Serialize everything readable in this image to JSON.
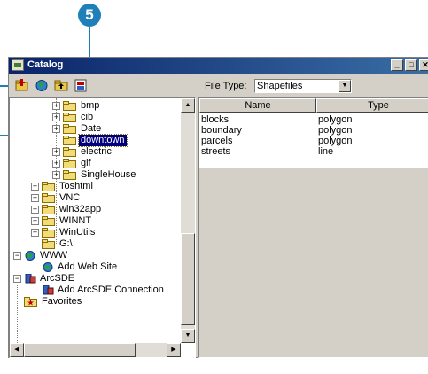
{
  "callout": {
    "number": "5",
    "color": "#1f7fb8"
  },
  "window": {
    "title": "Catalog"
  },
  "window_buttons": {
    "minimize": "_",
    "maximize": "□",
    "close": "✕"
  },
  "toolbar": {
    "buttons": [
      "connect-folder-icon",
      "globe-icon",
      "up-folder-icon",
      "launch-icon"
    ],
    "file_type_label": "File Type:",
    "file_type_value": "Shapefiles"
  },
  "tree": {
    "items": [
      {
        "label": "bmp",
        "expander": "+"
      },
      {
        "label": "cib",
        "expander": "+"
      },
      {
        "label": "Date",
        "expander": "+"
      },
      {
        "label": "downtown",
        "selected": true
      },
      {
        "label": "electric",
        "expander": "+"
      },
      {
        "label": "gif",
        "expander": "+"
      },
      {
        "label": "SingleHouse",
        "expander": "+"
      },
      {
        "label": "Toshtml",
        "expander": "+"
      },
      {
        "label": "VNC",
        "expander": "+"
      },
      {
        "label": "win32app",
        "expander": "+"
      },
      {
        "label": "WINNT",
        "expander": "+"
      },
      {
        "label": "WinUtils",
        "expander": "+"
      },
      {
        "label": "G:\\"
      },
      {
        "label": "WWW",
        "expander": "−"
      },
      {
        "label": "Add Web Site"
      },
      {
        "label": "ArcSDE",
        "expander": "−"
      },
      {
        "label": "Add ArcSDE Connection"
      },
      {
        "label": "Favorites"
      }
    ]
  },
  "list": {
    "columns": [
      "Name",
      "Type"
    ],
    "rows": [
      {
        "name": "blocks",
        "type": "polygon"
      },
      {
        "name": "boundary",
        "type": "polygon"
      },
      {
        "name": "parcels",
        "type": "polygon"
      },
      {
        "name": "streets",
        "type": "line"
      }
    ]
  }
}
